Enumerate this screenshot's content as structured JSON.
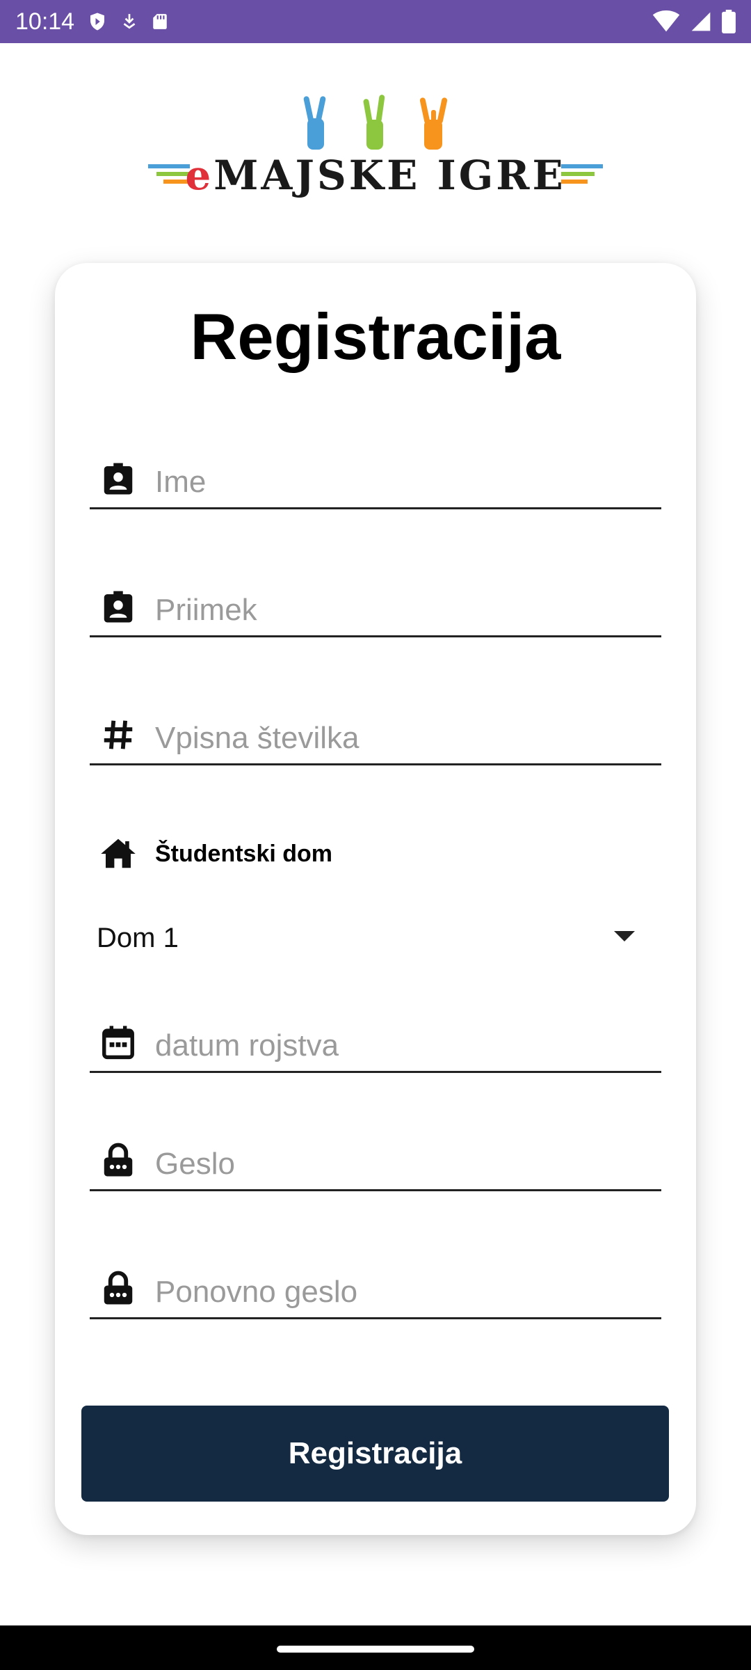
{
  "status_bar": {
    "time": "10:14",
    "left_icons": [
      "shield-icon",
      "download-icon",
      "sd-card-icon"
    ],
    "right_icons": [
      "wifi-icon",
      "signal-icon",
      "battery-icon"
    ],
    "background": "#6a4fa6"
  },
  "logo": {
    "prefix": "e",
    "text": "MAJSKE IGRE",
    "hand_colors": [
      "#4a9fd8",
      "#8dc63f",
      "#f7941d"
    ]
  },
  "form": {
    "title": "Registracija",
    "fields": [
      {
        "name": "first-name",
        "icon": "contact-badge-icon",
        "placeholder": "Ime",
        "value": ""
      },
      {
        "name": "last-name",
        "icon": "contact-badge-icon",
        "placeholder": "Priimek",
        "value": ""
      },
      {
        "name": "enrollment-number",
        "icon": "hash-icon",
        "placeholder": "Vpisna številka",
        "value": ""
      },
      {
        "name": "birth-date",
        "icon": "calendar-icon",
        "placeholder": "datum rojstva",
        "value": ""
      },
      {
        "name": "password",
        "icon": "lock-icon",
        "placeholder": "Geslo",
        "value": ""
      },
      {
        "name": "password-repeat",
        "icon": "lock-icon",
        "placeholder": "Ponovno geslo",
        "value": ""
      }
    ],
    "dorm": {
      "icon": "home-icon",
      "label": "Študentski dom",
      "selected": "Dom 1"
    },
    "submit_label": "Registracija",
    "submit_color": "#132a42"
  }
}
